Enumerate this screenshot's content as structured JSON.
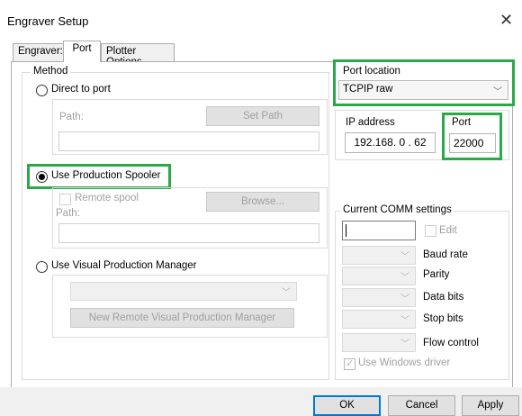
{
  "window": {
    "title": "Engraver Setup",
    "close_glyph": "✕"
  },
  "tabs": [
    {
      "label": "Engraver:"
    },
    {
      "label": "Port"
    },
    {
      "label": "Plotter Options"
    }
  ],
  "method": {
    "legend": "Method",
    "direct": {
      "label": "Direct to port",
      "path_label": "Path:",
      "set_path": "Set Path",
      "path_value": ""
    },
    "spooler": {
      "label": "Use Production Spooler",
      "remote_spool": "Remote spool",
      "browse": "Browse...",
      "path_label": "Path:",
      "path_value": ""
    },
    "vpm": {
      "label": "Use Visual Production Manager",
      "combo_value": "",
      "new_remote": "New Remote Visual Production Manager"
    }
  },
  "port_location": {
    "label": "Port location",
    "value": "TCPIP raw"
  },
  "network": {
    "ip_label": "IP address",
    "ip_value": "192.168. 0 . 62",
    "port_label": "Port",
    "port_value": "22000"
  },
  "comm": {
    "legend": "Current COMM settings",
    "edit": "Edit",
    "baud": "Baud rate",
    "parity": "Parity",
    "data_bits": "Data bits",
    "stop_bits": "Stop bits",
    "flow": "Flow control",
    "use_windows_driver": "Use Windows driver"
  },
  "footer": {
    "ok": "OK",
    "cancel": "Cancel",
    "apply": "Apply"
  },
  "colors": {
    "highlight": "#2aa84a",
    "accent": "#0078d7"
  }
}
